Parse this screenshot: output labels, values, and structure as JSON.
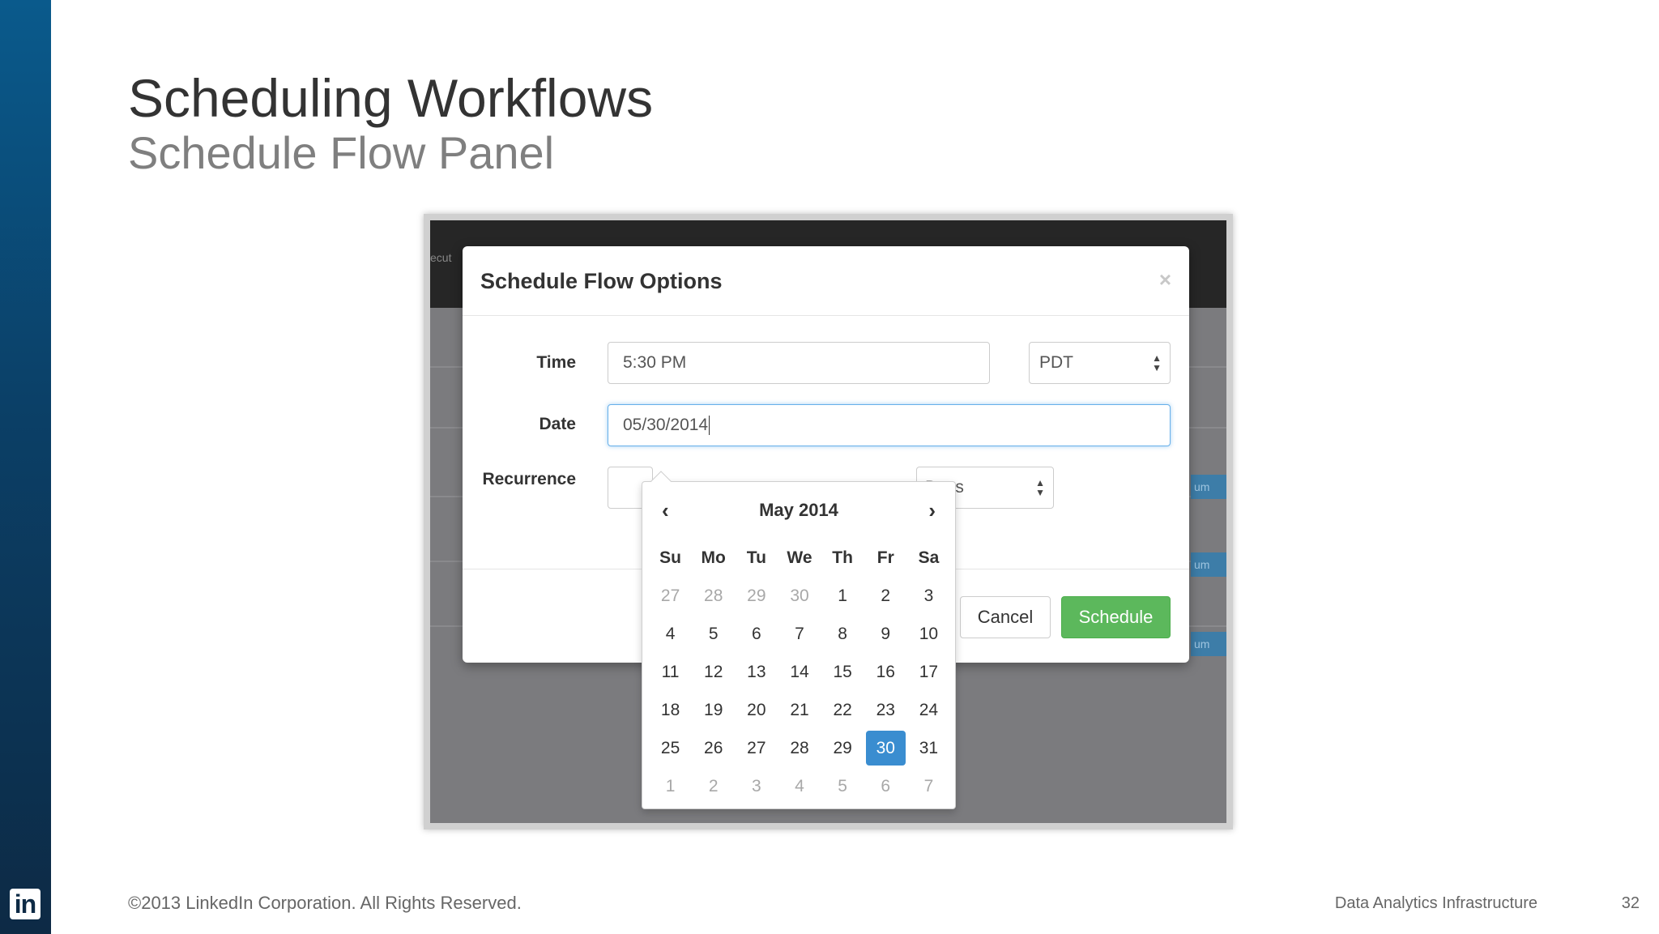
{
  "slide": {
    "title": "Scheduling Workflows",
    "subtitle": "Schedule Flow Panel",
    "copyright": "©2013 LinkedIn Corporation. All Rights Reserved.",
    "footer_label": "Data Analytics Infrastructure",
    "page_number": "32",
    "logo_text": "in"
  },
  "background_app": {
    "nav_fragment": "ecut",
    "pill_fragment": "um"
  },
  "modal": {
    "title": "Schedule Flow Options",
    "close": "×",
    "time_label": "Time",
    "time_value": "5:30 PM",
    "timezone_value": "PDT",
    "date_label": "Date",
    "date_value": "05/30/2014",
    "recurrence_label": "Recurrence",
    "recurrence_unit": "Days",
    "cancel_label": "Cancel",
    "schedule_label": "Schedule"
  },
  "datepicker": {
    "month_label": "May 2014",
    "prev": "‹",
    "next": "›",
    "weekdays": [
      "Su",
      "Mo",
      "Tu",
      "We",
      "Th",
      "Fr",
      "Sa"
    ],
    "weeks": [
      [
        "27",
        "28",
        "29",
        "30",
        "1",
        "2",
        "3"
      ],
      [
        "4",
        "5",
        "6",
        "7",
        "8",
        "9",
        "10"
      ],
      [
        "11",
        "12",
        "13",
        "14",
        "15",
        "16",
        "17"
      ],
      [
        "18",
        "19",
        "20",
        "21",
        "22",
        "23",
        "24"
      ],
      [
        "25",
        "26",
        "27",
        "28",
        "29",
        "30",
        "31"
      ],
      [
        "1",
        "2",
        "3",
        "4",
        "5",
        "6",
        "7"
      ]
    ],
    "selected_day": "30"
  },
  "colors": {
    "accent_blue": "#3a8dd0",
    "schedule_green": "#5cb85c",
    "sidebar_top": "#0a5a8c",
    "sidebar_bottom": "#0d2a45"
  }
}
